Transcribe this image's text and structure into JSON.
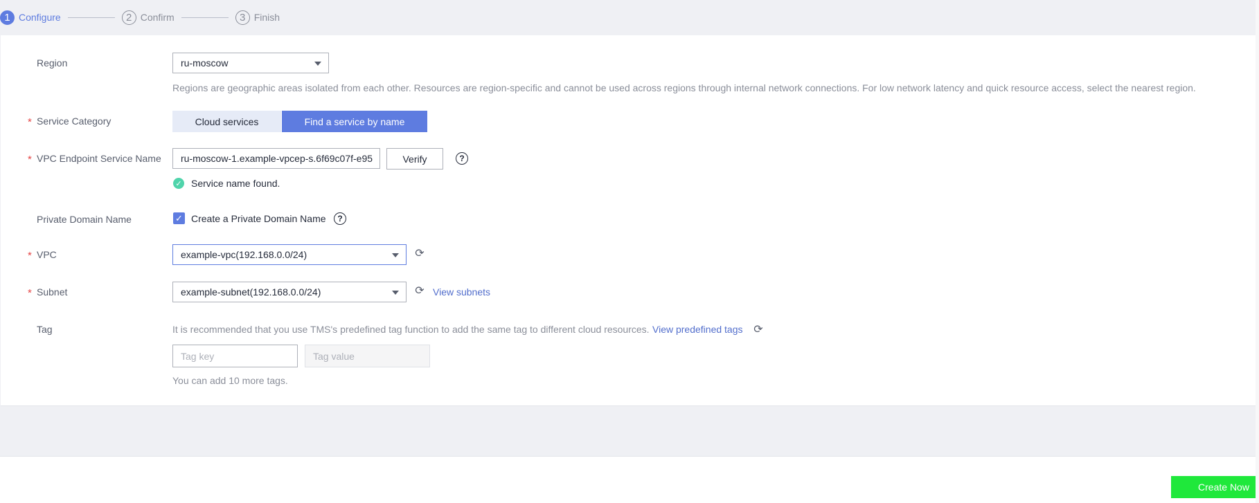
{
  "steps": [
    {
      "num": "1",
      "label": "Configure"
    },
    {
      "num": "2",
      "label": "Confirm"
    },
    {
      "num": "3",
      "label": "Finish"
    }
  ],
  "region": {
    "label": "Region",
    "value": "ru-moscow",
    "hint": "Regions are geographic areas isolated from each other. Resources are region-specific and cannot be used across regions through internal network connections. For low network latency and quick resource access, select the nearest region."
  },
  "service_category": {
    "label": "Service Category",
    "options": [
      "Cloud services",
      "Find a service by name"
    ]
  },
  "endpoint_service": {
    "label": "VPC Endpoint Service Name",
    "value": "ru-moscow-1.example-vpcep-s.6f69c07f-e95",
    "verify_label": "Verify",
    "status": "Service name found."
  },
  "private_domain": {
    "label": "Private Domain Name",
    "checkbox_label": "Create a Private Domain Name"
  },
  "vpc": {
    "label": "VPC",
    "value": "example-vpc(192.168.0.0/24)"
  },
  "subnet": {
    "label": "Subnet",
    "value": "example-subnet(192.168.0.0/24)",
    "link": "View subnets"
  },
  "tag": {
    "label": "Tag",
    "hint": "It is recommended that you use TMS's predefined tag function to add the same tag to different cloud resources.",
    "link": "View predefined tags",
    "key_placeholder": "Tag key",
    "value_placeholder": "Tag value",
    "remaining": "You can add 10 more tags."
  },
  "required_mark": "*",
  "footer": {
    "create_label": "Create Now"
  },
  "colors": {
    "accent": "#5e7ce0",
    "link": "#526ecc",
    "success": "#50d4ab",
    "required": "#e54545",
    "primary_button": "#1fe83b"
  }
}
